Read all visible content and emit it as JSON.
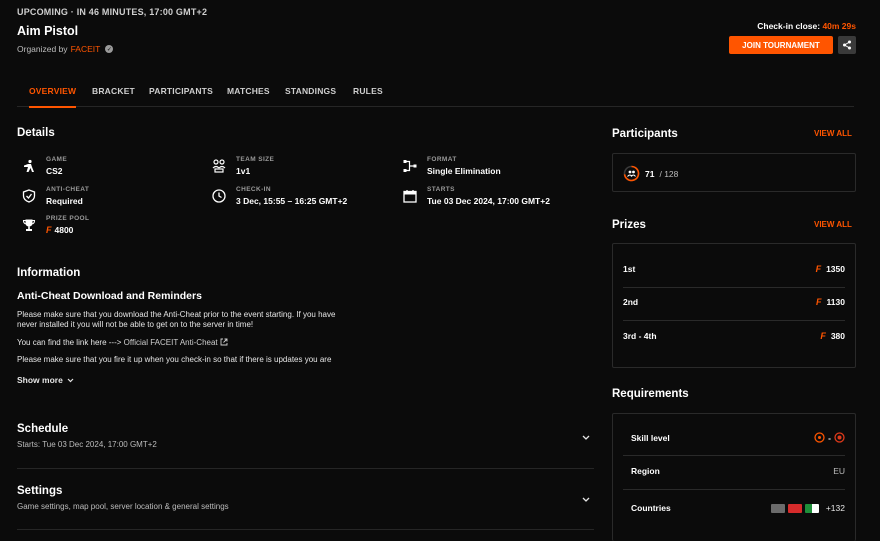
{
  "header": {
    "status": "UPCOMING · IN 46 MINUTES, 17:00 GMT+2",
    "title": "Aim Pistol",
    "organized_by_label": "Organized by",
    "organizer": "FACEIT",
    "checkin_label": "Check-in close:",
    "checkin_time": "40m 29s",
    "join_label": "JOIN TOURNAMENT"
  },
  "tabs": [
    "OVERVIEW",
    "BRACKET",
    "PARTICIPANTS",
    "MATCHES",
    "STANDINGS",
    "RULES"
  ],
  "details": {
    "heading": "Details",
    "game": {
      "label": "GAME",
      "value": "CS2",
      "icon": "gamepad-player-icon"
    },
    "team_size": {
      "label": "TEAM SIZE",
      "value": "1v1",
      "icon": "team-icon"
    },
    "format": {
      "label": "FORMAT",
      "value": "Single Elimination",
      "icon": "bracket-icon"
    },
    "anti_cheat": {
      "label": "ANTI-CHEAT",
      "value": "Required",
      "icon": "shield-icon"
    },
    "check_in": {
      "label": "CHECK-IN",
      "value": "3 Dec, 15:55 – 16:25 GMT+2",
      "icon": "clock-icon"
    },
    "starts": {
      "label": "STARTS",
      "value": "Tue 03 Dec 2024, 17:00 GMT+2",
      "icon": "calendar-icon"
    },
    "prize_pool": {
      "label": "PRIZE POOL",
      "value": "4800",
      "icon": "trophy-icon"
    }
  },
  "information": {
    "heading": "Information",
    "subheading": "Anti-Cheat Download and Reminders",
    "para1": "Please make sure that you download the Anti-Cheat prior to the event starting. If you have never installed it you will not be able to get on to the server in time!",
    "para2_prefix": "You can find the link here --->",
    "para2_link": "Official FACEIT Anti-Cheat",
    "para3": "Please make sure that you fire it up when you check-in so that if there is updates you are",
    "show_more": "Show more"
  },
  "schedule": {
    "heading": "Schedule",
    "sub": "Starts: Tue 03 Dec 2024, 17:00 GMT+2"
  },
  "settings": {
    "heading": "Settings",
    "sub": "Game settings, map pool, server location & general settings"
  },
  "participants": {
    "heading": "Participants",
    "view_all": "VIEW ALL",
    "count": "71",
    "max": "/ 128"
  },
  "prizes": {
    "heading": "Prizes",
    "view_all": "VIEW ALL",
    "rows": [
      {
        "place": "1st",
        "amount": "1350"
      },
      {
        "place": "2nd",
        "amount": "1130"
      },
      {
        "place": "3rd - 4th",
        "amount": "380"
      }
    ]
  },
  "requirements": {
    "heading": "Requirements",
    "skill_label": "Skill level",
    "skill_sep": "-",
    "region_label": "Region",
    "region_value": "EU",
    "countries_label": "Countries",
    "countries_more": "+132"
  },
  "colors": {
    "accent": "#ff5500",
    "background": "#0b0b0b"
  }
}
